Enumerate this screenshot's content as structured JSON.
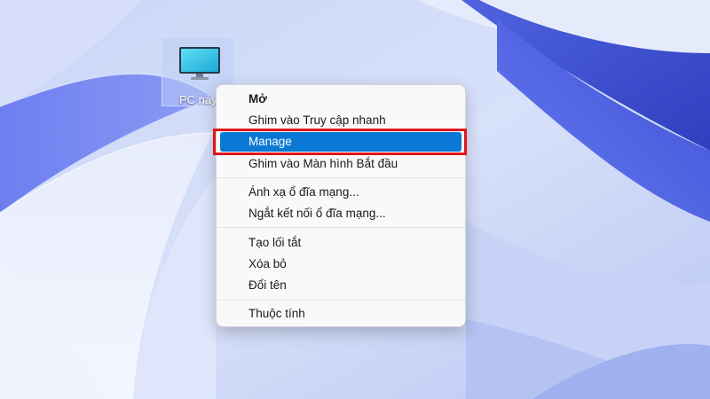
{
  "desktop": {
    "icon": {
      "label": "PC này",
      "icon_name": "computer-monitor-icon"
    }
  },
  "context_menu": {
    "groups": [
      [
        {
          "label": "Mở",
          "bold": true
        },
        {
          "label": "Ghim vào Truy cập nhanh"
        },
        {
          "label": "Manage",
          "selected": true
        },
        {
          "label": "Ghim vào Màn hình Bắt đầu"
        }
      ],
      [
        {
          "label": "Ánh xạ ổ đĩa mạng..."
        },
        {
          "label": "Ngắt kết nối ổ đĩa mạng..."
        }
      ],
      [
        {
          "label": "Tạo lối tắt"
        },
        {
          "label": "Xóa bỏ"
        },
        {
          "label": "Đổi tên"
        }
      ],
      [
        {
          "label": "Thuộc tính"
        }
      ]
    ]
  },
  "colors": {
    "selection": "#0a78d4",
    "highlight_border": "#e0141e",
    "menu_background": "#f9f9f9"
  }
}
